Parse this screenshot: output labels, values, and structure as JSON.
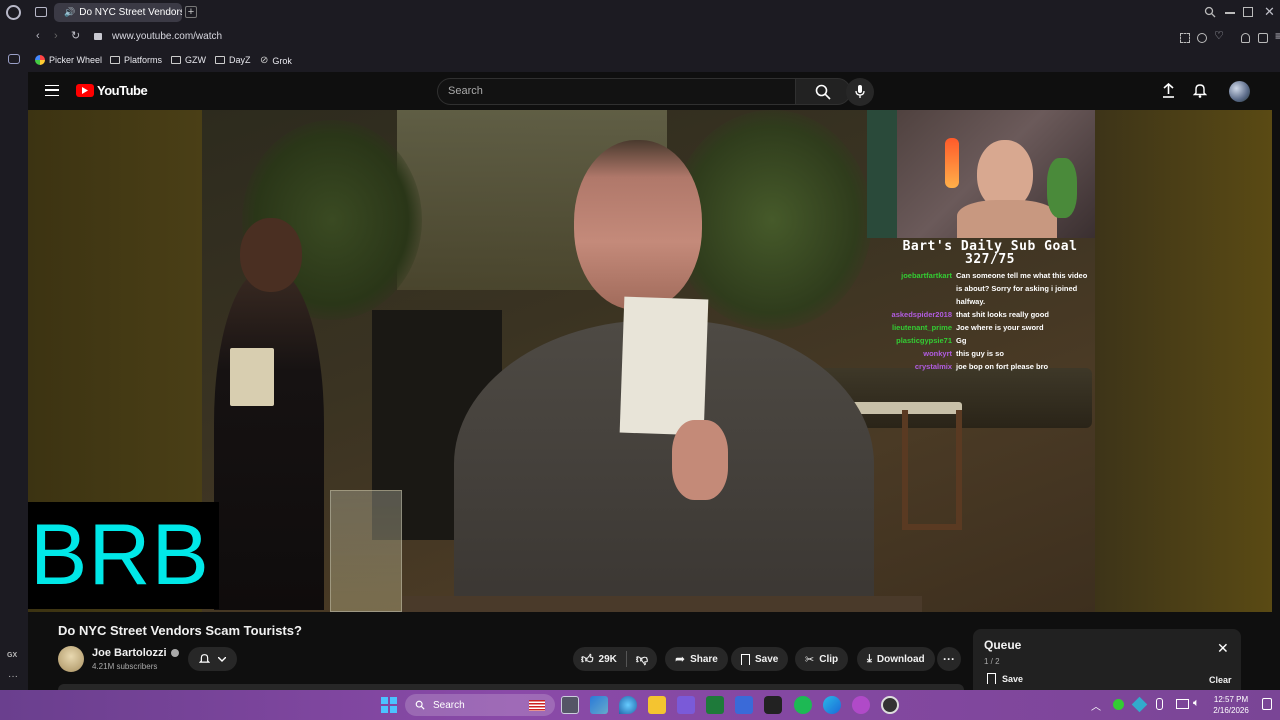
{
  "browser": {
    "tab_title": "Do NYC Street Vendors",
    "url": "www.youtube.com/watch",
    "bookmarks": [
      "Picker Wheel",
      "Platforms",
      "GZW",
      "DayZ",
      "Grok"
    ],
    "sidebar_label": "GX"
  },
  "youtube": {
    "logo_text": "YouTube",
    "search_placeholder": "Search"
  },
  "overlay": {
    "chat_title": "Bart's Daily Sub Goal 327/75",
    "chat": [
      {
        "user": "joebartfartkart",
        "msg": "Can someone tell me what this video is about? Sorry for asking i joined halfway.",
        "color": "#33cc33"
      },
      {
        "user": "askedspider2018",
        "msg": "that shit looks really good",
        "color": "#b15ce0"
      },
      {
        "user": "lieutenant_prime",
        "msg": "Joe where is your sword",
        "color": "#33cc33"
      },
      {
        "user": "plasticgypsie71",
        "msg": "Gg",
        "color": "#33cc33"
      },
      {
        "user": "wonkyrt",
        "msg": "this guy is so",
        "color": "#b15ce0"
      },
      {
        "user": "crystalmix",
        "msg": "joe bop on fort please bro",
        "color": "#b15ce0"
      }
    ],
    "brb_text": "BRB"
  },
  "video": {
    "title": "Do NYC Street Vendors Scam Tourists?",
    "channel": "Joe Bartolozzi",
    "subscribers": "4.21M subscribers",
    "likes": "29K",
    "share_label": "Share",
    "save_label": "Save",
    "clip_label": "Clip",
    "download_label": "Download"
  },
  "queue": {
    "title": "Queue",
    "position": "1 / 2",
    "save_label": "Save",
    "clear_label": "Clear"
  },
  "taskbar": {
    "search_label": "Search",
    "time": "12:57 PM",
    "date": "2/16/2026"
  }
}
